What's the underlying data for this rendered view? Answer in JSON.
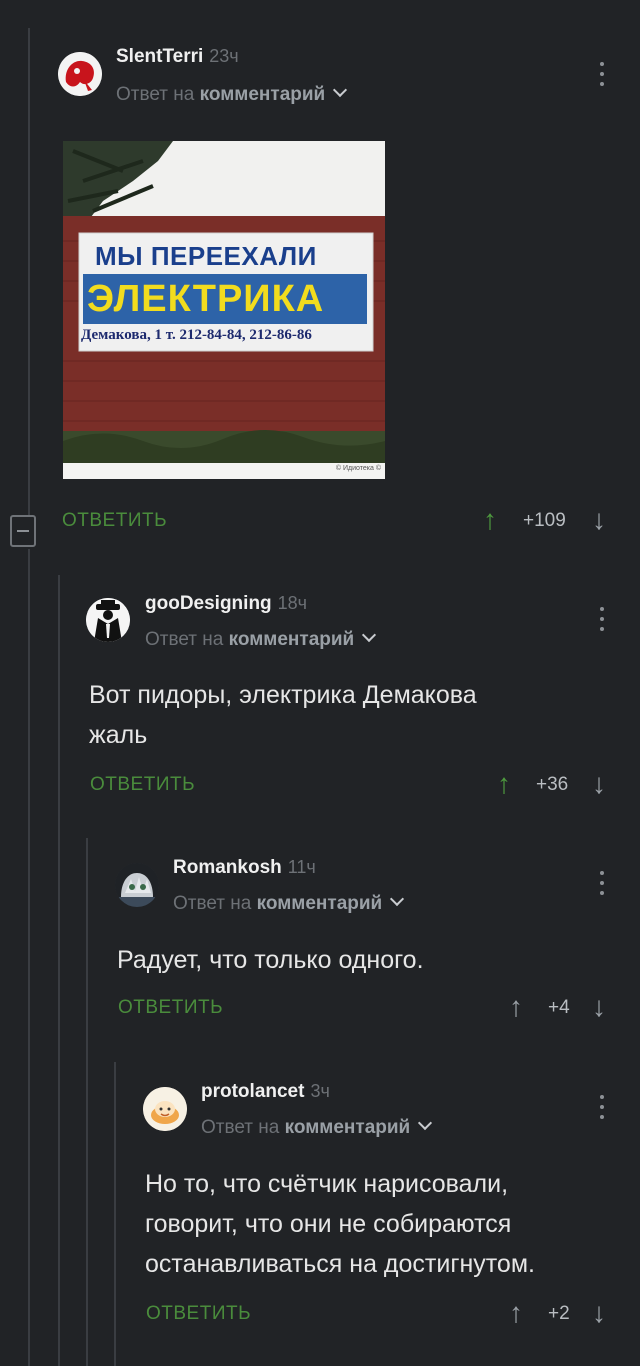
{
  "comments": [
    {
      "username": "SlentTerri",
      "time": "23ч",
      "reply_prefix": "Ответ на",
      "reply_target": "комментарий",
      "reply_label": "ОТВЕТИТЬ",
      "votes": "+109",
      "image": {
        "sign_line1": "МЫ ПЕРЕЕХАЛИ",
        "sign_line2": "ЭЛЕКТРИКА",
        "sign_line3": "Демакова, 1  т. 212-84-84, 212-86-86",
        "watermark": "© Идиотека ©"
      },
      "upvote_color": "#4e9a3e"
    },
    {
      "username": "gooDesigning",
      "time": "18ч",
      "reply_prefix": "Ответ на",
      "reply_target": "комментарий",
      "text_line1": "Вот пидоры, электрика Демакова",
      "text_line2": "жаль",
      "reply_label": "ОТВЕТИТЬ",
      "votes": "+36",
      "upvote_color": "#4e9a3e"
    },
    {
      "username": "Romankosh",
      "time": "11ч",
      "reply_prefix": "Ответ на",
      "reply_target": "комментарий",
      "text_line1": "Радует, что только одного.",
      "reply_label": "ОТВЕТИТЬ",
      "votes": "+4",
      "upvote_color": "#9aa0a6"
    },
    {
      "username": "protolancet",
      "time": "3ч",
      "reply_prefix": "Ответ на",
      "reply_target": "комментарий",
      "text_line1": "Но то, что счётчик нарисовали,",
      "text_line2": "говорит, что они не собираются",
      "text_line3": "останавливаться на достигнутом.",
      "reply_label": "ОТВЕТИТЬ",
      "votes": "+2",
      "upvote_color": "#9aa0a6"
    }
  ],
  "icons": {
    "upvote": "↑",
    "downvote": "↓"
  },
  "colors": {
    "background": "#212326",
    "accent_green": "#4a8c3c"
  }
}
